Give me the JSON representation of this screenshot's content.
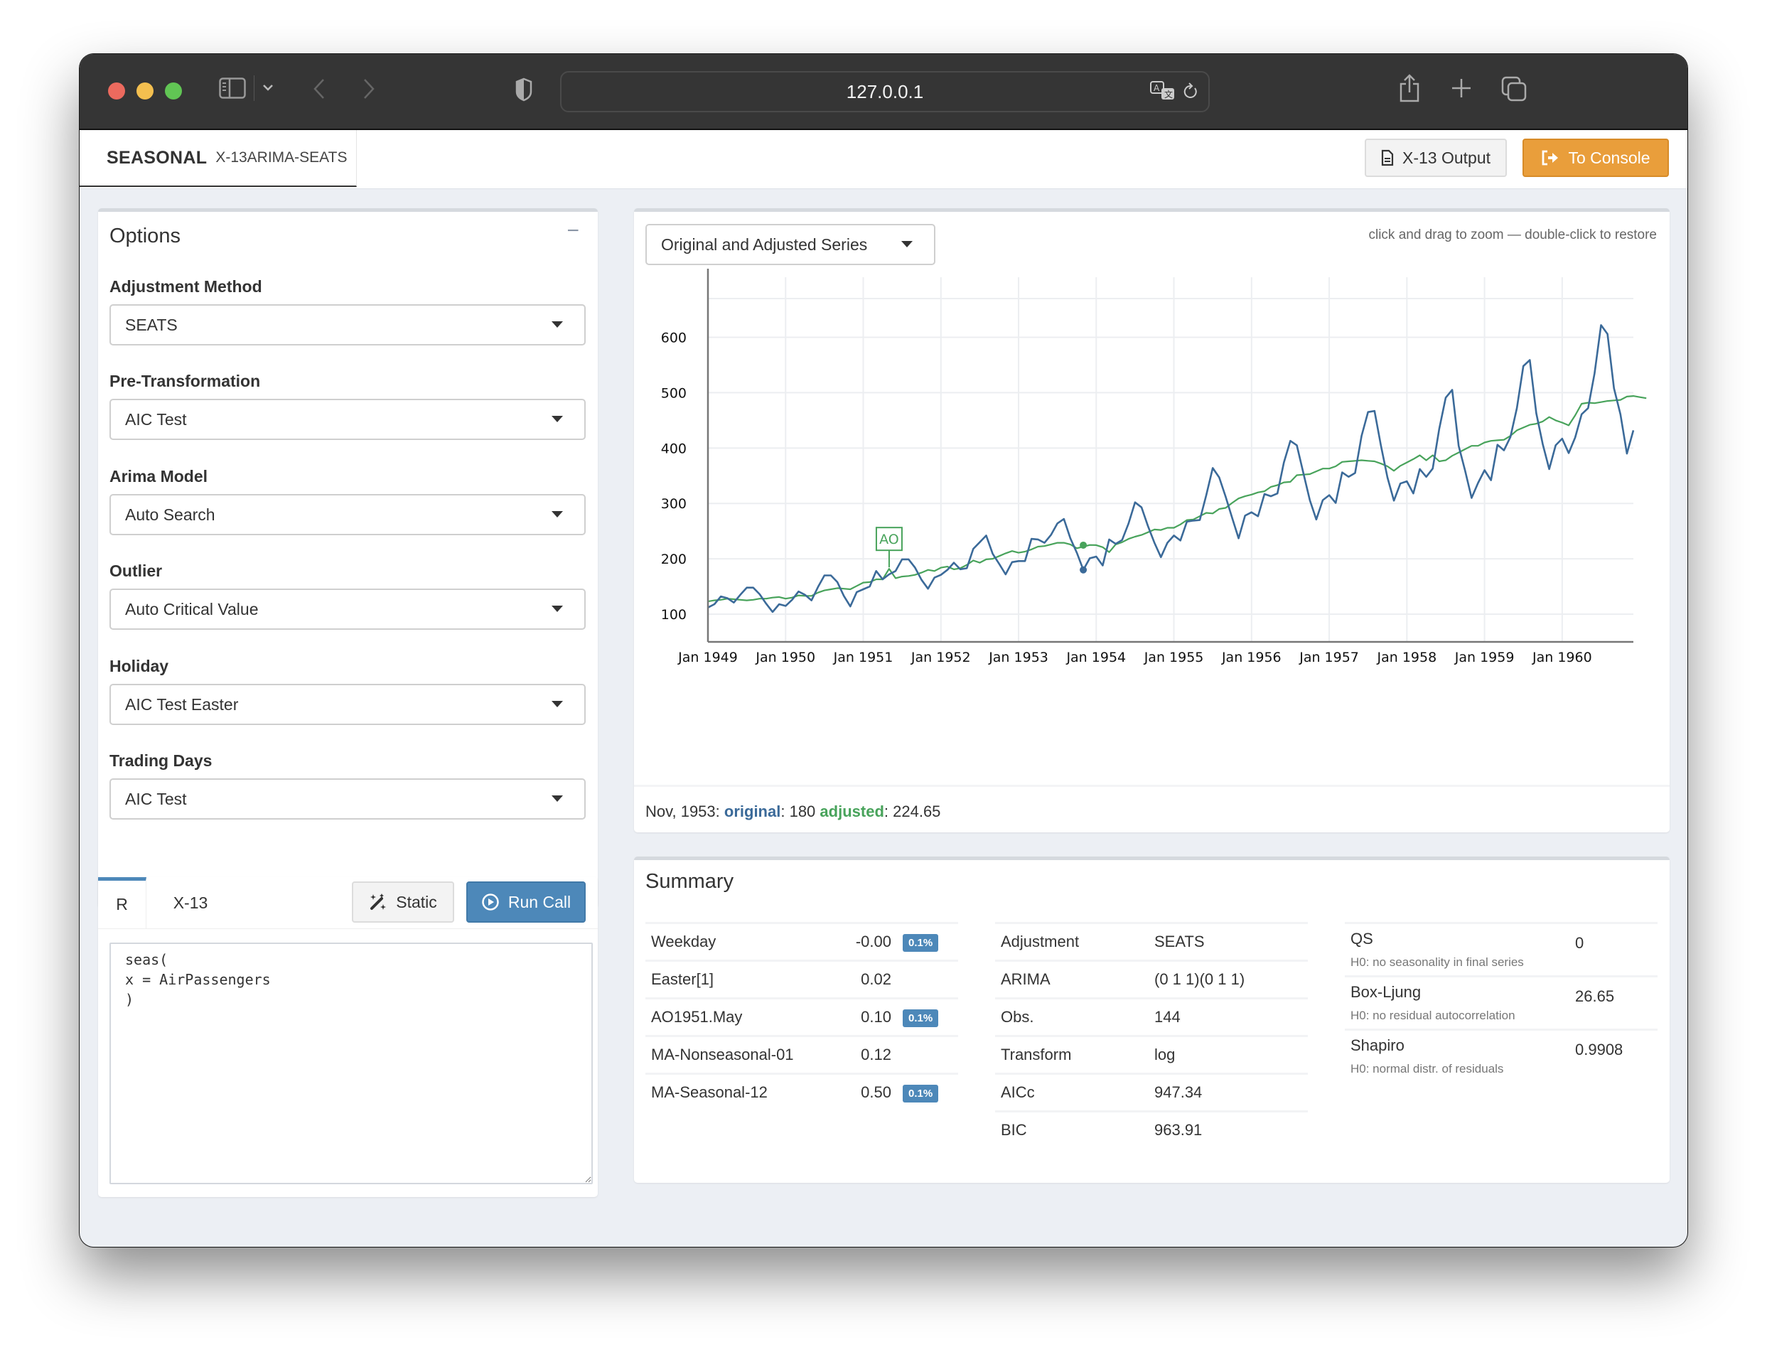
{
  "browser": {
    "url": "127.0.0.1",
    "icons": [
      "sidebar-toggle-icon",
      "chevron-down-icon",
      "back-icon",
      "forward-icon",
      "shield-icon",
      "translate-icon",
      "reload-icon",
      "share-icon",
      "new-tab-icon",
      "tabs-overview-icon"
    ]
  },
  "navbar": {
    "brand_main": "SEASONAL",
    "brand_sub": "X-13ARIMA-SEATS",
    "output_button": "X-13 Output",
    "console_button": "To Console"
  },
  "options": {
    "title": "Options",
    "collapse_symbol": "−",
    "fields": [
      {
        "label": "Adjustment Method",
        "value": "SEATS"
      },
      {
        "label": "Pre-Transformation",
        "value": "AIC Test"
      },
      {
        "label": "Arima Model",
        "value": "Auto Search"
      },
      {
        "label": "Outlier",
        "value": "Auto Critical Value"
      },
      {
        "label": "Holiday",
        "value": "AIC Test Easter"
      },
      {
        "label": "Trading Days",
        "value": "AIC Test"
      }
    ]
  },
  "call_panel": {
    "tabs": [
      {
        "label": "R",
        "active": true
      },
      {
        "label": "X-13",
        "active": false
      }
    ],
    "static_button": "Static",
    "run_button": "Run Call",
    "code": "seas(\nx = AirPassengers\n)"
  },
  "chart_panel": {
    "view_select": "Original and Adjusted Series",
    "hint": "click and drag to zoom — double-click to restore",
    "tooltip": {
      "date": "Nov, 1953",
      "original_label": "original",
      "original_value": "180",
      "adjusted_label": "adjusted",
      "adjusted_value": "224.65"
    }
  },
  "chart_data": {
    "type": "line",
    "title": "Original and Adjusted Series",
    "xlabel": "",
    "ylabel": "",
    "x_start": "1949-01",
    "x_end": "1960-12",
    "frequency": "monthly",
    "ylim": [
      50,
      670
    ],
    "yticks": [
      100,
      200,
      300,
      400,
      500,
      600
    ],
    "xtick_labels": [
      "Jan 1949",
      "Jan 1950",
      "Jan 1951",
      "Jan 1952",
      "Jan 1953",
      "Jan 1954",
      "Jan 1955",
      "Jan 1956",
      "Jan 1957",
      "Jan 1958",
      "Jan 1959",
      "Jan 1960"
    ],
    "grid": true,
    "colors": {
      "original": "#3b6a99",
      "adjusted": "#48a35b"
    },
    "annotations": [
      {
        "label": "AO",
        "date": "1951-05",
        "series": "adjusted"
      }
    ],
    "highlight": {
      "date": "1953-11",
      "original": 180,
      "adjusted": 224.65
    },
    "series": [
      {
        "name": "original",
        "values": [
          112,
          118,
          132,
          129,
          121,
          135,
          148,
          148,
          136,
          119,
          104,
          118,
          115,
          126,
          141,
          135,
          125,
          149,
          170,
          170,
          158,
          133,
          114,
          140,
          145,
          150,
          178,
          163,
          172,
          178,
          199,
          199,
          184,
          162,
          146,
          166,
          171,
          180,
          193,
          181,
          183,
          218,
          230,
          242,
          209,
          191,
          172,
          194,
          196,
          196,
          236,
          235,
          229,
          243,
          264,
          272,
          237,
          211,
          180,
          201,
          204,
          188,
          235,
          227,
          234,
          264,
          302,
          293,
          259,
          229,
          203,
          229,
          242,
          233,
          267,
          269,
          270,
          315,
          364,
          347,
          312,
          274,
          237,
          278,
          284,
          277,
          317,
          313,
          318,
          374,
          413,
          405,
          355,
          306,
          271,
          306,
          315,
          301,
          356,
          348,
          355,
          422,
          465,
          467,
          404,
          347,
          305,
          336,
          340,
          318,
          362,
          348,
          363,
          435,
          491,
          505,
          404,
          359,
          310,
          337,
          360,
          342,
          406,
          396,
          420,
          472,
          548,
          559,
          463,
          407,
          362,
          405,
          417,
          391,
          419,
          461,
          472,
          535,
          622,
          606,
          508,
          461,
          390,
          432
        ]
      },
      {
        "name": "adjusted",
        "values": [
          123,
          125,
          126,
          128,
          127,
          126,
          125,
          126,
          128,
          128,
          130,
          131,
          128,
          130,
          134,
          133,
          133,
          139,
          143,
          145,
          147,
          146,
          145,
          151,
          157,
          158,
          163,
          163,
          182,
          165,
          168,
          169,
          171,
          175,
          180,
          178,
          184,
          186,
          181,
          183,
          189,
          197,
          193,
          199,
          200,
          205,
          210,
          214,
          211,
          213,
          217,
          222,
          223,
          226,
          229,
          229,
          226,
          219,
          222,
          225,
          224.65,
          221,
          212,
          226,
          230,
          236,
          240,
          243,
          248,
          253,
          252,
          256,
          256,
          262,
          270,
          271,
          277,
          283,
          282,
          290,
          292,
          301,
          309,
          313,
          316,
          320,
          322,
          330,
          333,
          338,
          339,
          351,
          352,
          353,
          358,
          363,
          363,
          367,
          375,
          376,
          377,
          378,
          377,
          376,
          372,
          367,
          359,
          368,
          374,
          380,
          387,
          378,
          387,
          376,
          378,
          386,
          392,
          398,
          404,
          404,
          410,
          413,
          414,
          415,
          422,
          432,
          437,
          442,
          444,
          448,
          456,
          450,
          446,
          441,
          459,
          480,
          482,
          481,
          483,
          485,
          486,
          487,
          493,
          494,
          492,
          490
        ]
      }
    ]
  },
  "summary": {
    "title": "Summary",
    "coefficients": [
      {
        "name": "Weekday",
        "value": "-0.00",
        "badge": "0.1%"
      },
      {
        "name": "Easter[1]",
        "value": "0.02",
        "badge": ""
      },
      {
        "name": "AO1951.May",
        "value": "0.10",
        "badge": "0.1%"
      },
      {
        "name": "MA-Nonseasonal-01",
        "value": "0.12",
        "badge": ""
      },
      {
        "name": "MA-Seasonal-12",
        "value": "0.50",
        "badge": "0.1%"
      }
    ],
    "model": [
      {
        "name": "Adjustment",
        "value": "SEATS"
      },
      {
        "name": "ARIMA",
        "value": "(0 1 1)(0 1 1)"
      },
      {
        "name": "Obs.",
        "value": "144"
      },
      {
        "name": "Transform",
        "value": "log"
      },
      {
        "name": "AICc",
        "value": "947.34"
      },
      {
        "name": "BIC",
        "value": "963.91"
      }
    ],
    "tests": [
      {
        "name": "QS",
        "value": "0",
        "description": "H0: no seasonality in final series"
      },
      {
        "name": "Box-Ljung",
        "value": "26.65",
        "description": "H0: no residual autocorrelation"
      },
      {
        "name": "Shapiro",
        "value": "0.9908",
        "description": "H0: normal distr. of residuals"
      }
    ]
  }
}
